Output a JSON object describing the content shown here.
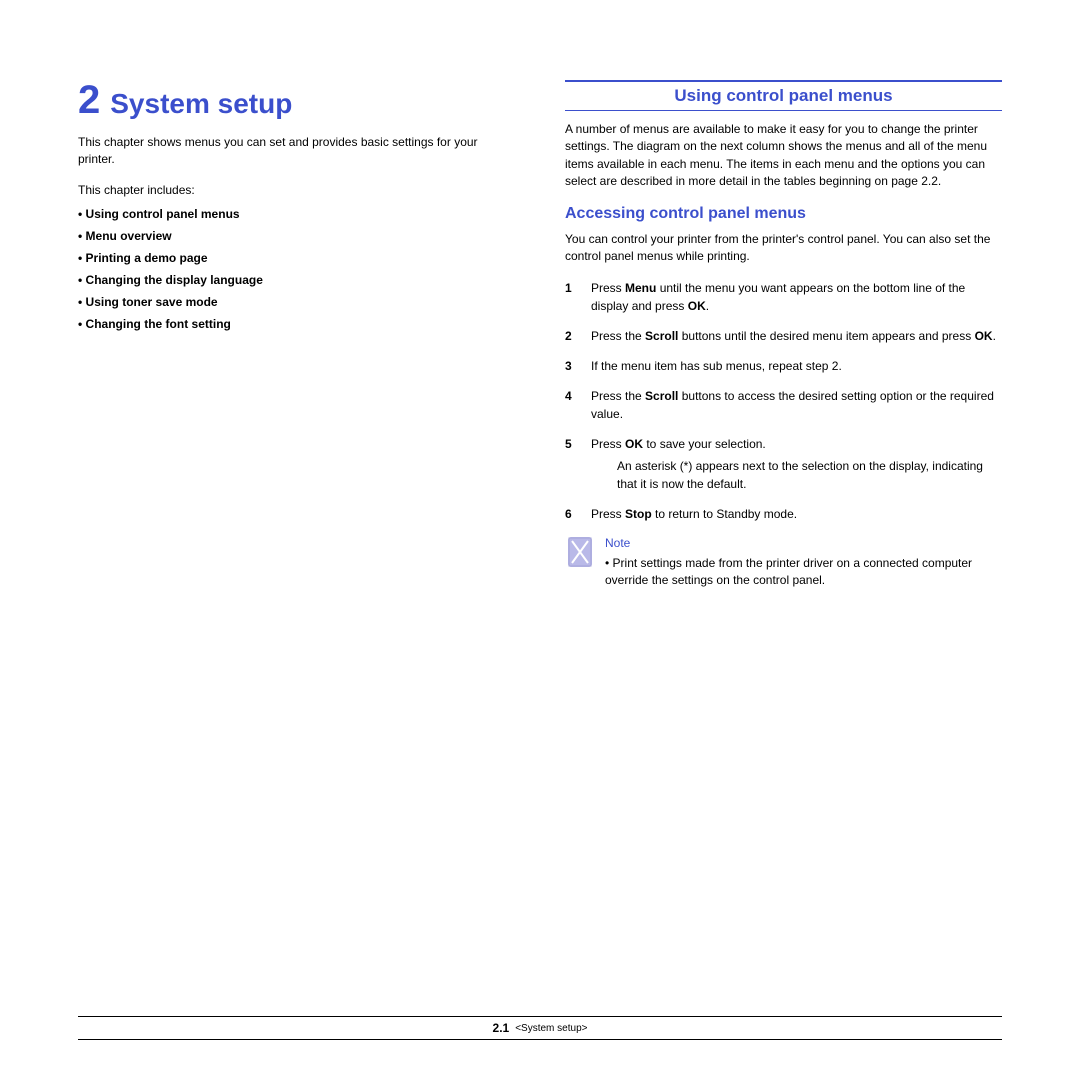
{
  "chapter": {
    "number": "2",
    "title": "System setup"
  },
  "intro": "This chapter shows menus you can set and provides basic settings for your printer.",
  "includes_label": "This chapter includes:",
  "toc": [
    "Using control panel menus",
    "Menu overview",
    "Printing a demo page",
    "Changing the display language",
    "Using toner save mode",
    "Changing the font setting"
  ],
  "section1": {
    "title": "Using control panel menus",
    "para": "A number of menus are available to make it easy for you to change the printer settings. The diagram on the next column shows the menus and all of the menu items available in each menu. The items in each menu and the options you can select are described in more detail in the tables beginning on page 2.2."
  },
  "subsection": {
    "title": "Accessing control panel menus",
    "para": "You can control your printer from the printer's control panel. You can also set the control panel menus while printing.",
    "steps": [
      {
        "n": "1",
        "t_pre": "Press ",
        "b1": "Menu",
        "t_mid": " until the menu you want appears on the bottom line of the display and press ",
        "b2": "OK",
        "t_post": "."
      },
      {
        "n": "2",
        "t_pre": "Press the ",
        "b1": "Scroll",
        "t_mid": " buttons until the desired menu item appears and press ",
        "b2": "OK",
        "t_post": "."
      },
      {
        "n": "3",
        "plain": "If the menu item has sub menus, repeat step 2."
      },
      {
        "n": "4",
        "t_pre": "Press the ",
        "b1": "Scroll",
        "t_mid": " buttons to access the desired setting option or the required value.",
        "b2": "",
        "t_post": ""
      },
      {
        "n": "5",
        "t_pre": "Press ",
        "b1": "OK",
        "t_mid": " to save your selection.",
        "b2": "",
        "t_post": "",
        "extra": "An asterisk (*) appears next to the selection on the display, indicating that it is now the default."
      },
      {
        "n": "6",
        "t_pre": "Press ",
        "b1": "Stop",
        "t_mid": " to return to Standby mode.",
        "b2": "",
        "t_post": ""
      }
    ]
  },
  "note": {
    "label": "Note",
    "text": "Print settings made from the printer driver on a connected computer override the settings on the control panel."
  },
  "footer": {
    "pagenum": "2.1",
    "crumb": "<System setup>"
  }
}
